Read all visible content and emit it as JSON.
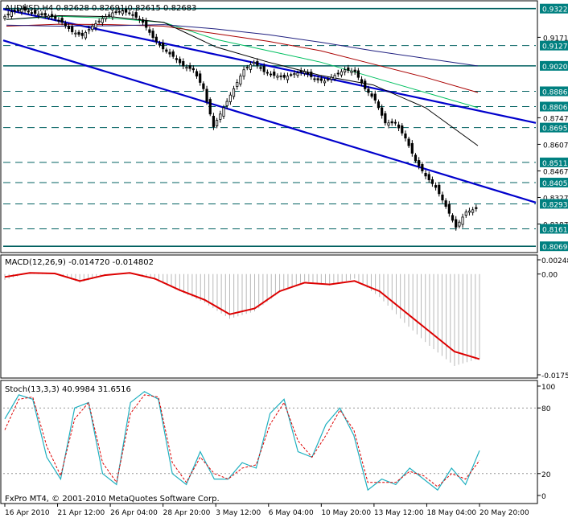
{
  "window": {
    "title_line": "AUDUSD,H4  0.82628 0.82691 0.82615 0.82683",
    "copyright": "FxPro MT4, © 2001-2010 MetaQuotes Software Corp."
  },
  "colors": {
    "background": "#ffffff",
    "frame": "#000000",
    "candle_body": "#000000",
    "channel_line": "#0000cc",
    "level_line": "#006060",
    "level_label_bg": "#008080",
    "ma_fast": "#00c060",
    "ma_mid": "#aa0000",
    "ma_slow": "#202080",
    "ma_black": "#000000",
    "macd_histogram": "#b8b8b8",
    "macd_signal": "#dd0000",
    "stoch_main": "#20b0c0",
    "stoch_signal": "#dd0000"
  },
  "chart_data": [
    {
      "type": "candlestick",
      "title": "AUDUSD,H4",
      "ohlc_header": {
        "open": 0.82628,
        "high": 0.82691,
        "low": 0.82615,
        "close": 0.82683
      },
      "x_tick_labels": [
        "16 Apr 2010",
        "21 Apr 12:00",
        "26 Apr 04:00",
        "28 Apr 20:00",
        "3 May 12:00",
        "6 May 04:00",
        "10 May 20:00",
        "13 May 12:00",
        "18 May 04:00",
        "20 May 20:00"
      ],
      "y_tick_labels": [
        "0.91710",
        "0.87470",
        "0.86070",
        "0.84670",
        "0.83270",
        "0.81870"
      ],
      "ylim": [
        0.8045,
        0.9355
      ],
      "highlighted_levels": [
        "0.93224",
        "0.91275",
        "0.90206",
        "0.88865",
        "0.88060",
        "0.86953",
        "0.85118",
        "0.84055",
        "0.82932",
        "0.81617",
        "0.80697"
      ],
      "dashed_levels": [
        "0.91275",
        "0.88865",
        "0.88060",
        "0.86953",
        "0.85118",
        "0.84055",
        "0.82932",
        "0.81617"
      ],
      "solid_levels": [
        "0.93224",
        "0.90206",
        "0.80697"
      ],
      "last_price": "0.82932",
      "price_path": [
        0.927,
        0.9305,
        0.932,
        0.93,
        0.929,
        0.928,
        0.925,
        0.92,
        0.918,
        0.923,
        0.927,
        0.93,
        0.931,
        0.929,
        0.925,
        0.917,
        0.911,
        0.907,
        0.902,
        0.9,
        0.89,
        0.87,
        0.88,
        0.89,
        0.9,
        0.904,
        0.899,
        0.897,
        0.896,
        0.898,
        0.899,
        0.895,
        0.894,
        0.897,
        0.9,
        0.899,
        0.89,
        0.884,
        0.872,
        0.872,
        0.864,
        0.852,
        0.844,
        0.838,
        0.828,
        0.817,
        0.825,
        0.8268
      ],
      "channel_lines": [
        {
          "name": "upper trendline",
          "from": 0.932,
          "to": 0.872
        },
        {
          "name": "lower trendline",
          "from": 0.9155,
          "to": 0.83
        }
      ],
      "moving_averages": [
        {
          "color": "ma_fast",
          "values": [
            0.9265,
            0.9282,
            0.9272,
            0.925,
            0.916,
            0.91,
            0.904,
            0.896,
            0.888,
            0.88
          ]
        },
        {
          "color": "ma_mid",
          "values": [
            0.923,
            0.924,
            0.9238,
            0.923,
            0.919,
            0.915,
            0.91,
            0.903,
            0.896,
            0.888
          ]
        },
        {
          "color": "ma_slow",
          "values": [
            0.9235,
            0.923,
            0.9232,
            0.9238,
            0.9215,
            0.9185,
            0.9145,
            0.91,
            0.906,
            0.902
          ]
        },
        {
          "color": "ma_black",
          "values": [
            0.9265,
            0.9285,
            0.928,
            0.925,
            0.912,
            0.904,
            0.897,
            0.892,
            0.88,
            0.86
          ]
        }
      ]
    },
    {
      "type": "line",
      "title": "MACD(12,26,9) -0.014720 -0.014802",
      "y_tick_labels": [
        "0.002480",
        "0.00",
        "-0.01755"
      ],
      "ylim": [
        -0.01755,
        0.00248
      ],
      "signal_line": [
        -0.0005,
        0.0002,
        0.0001,
        -0.0012,
        -0.0002,
        0.0002,
        -0.0008,
        -0.0028,
        -0.0045,
        -0.007,
        -0.006,
        -0.003,
        -0.0015,
        -0.0018,
        -0.0012,
        -0.003,
        -0.0065,
        -0.01,
        -0.0135,
        -0.0148
      ],
      "histogram": [
        -0.001,
        0.0002,
        0.0001,
        -0.0015,
        -0.0003,
        0.0002,
        -0.001,
        -0.003,
        -0.005,
        -0.0078,
        -0.0065,
        -0.0032,
        -0.0012,
        -0.002,
        -0.0008,
        -0.004,
        -0.0085,
        -0.0125,
        -0.016,
        -0.0147
      ]
    },
    {
      "type": "line",
      "title": "Stoch(13,3,3) 40.9984 31.6516",
      "y_tick_labels": [
        "100",
        "80",
        "20",
        "0"
      ],
      "ylim": [
        0,
        100
      ],
      "main_line": [
        70,
        92,
        88,
        35,
        15,
        80,
        85,
        20,
        10,
        85,
        95,
        88,
        20,
        10,
        40,
        15,
        15,
        30,
        25,
        75,
        88,
        40,
        35,
        65,
        80,
        55,
        5,
        15,
        10,
        25,
        15,
        5,
        25,
        10,
        41
      ],
      "signal_line": [
        60,
        88,
        90,
        45,
        18,
        70,
        85,
        30,
        12,
        75,
        92,
        90,
        30,
        12,
        35,
        20,
        15,
        25,
        28,
        65,
        85,
        50,
        35,
        55,
        78,
        60,
        12,
        12,
        12,
        22,
        18,
        8,
        20,
        15,
        32
      ]
    }
  ]
}
